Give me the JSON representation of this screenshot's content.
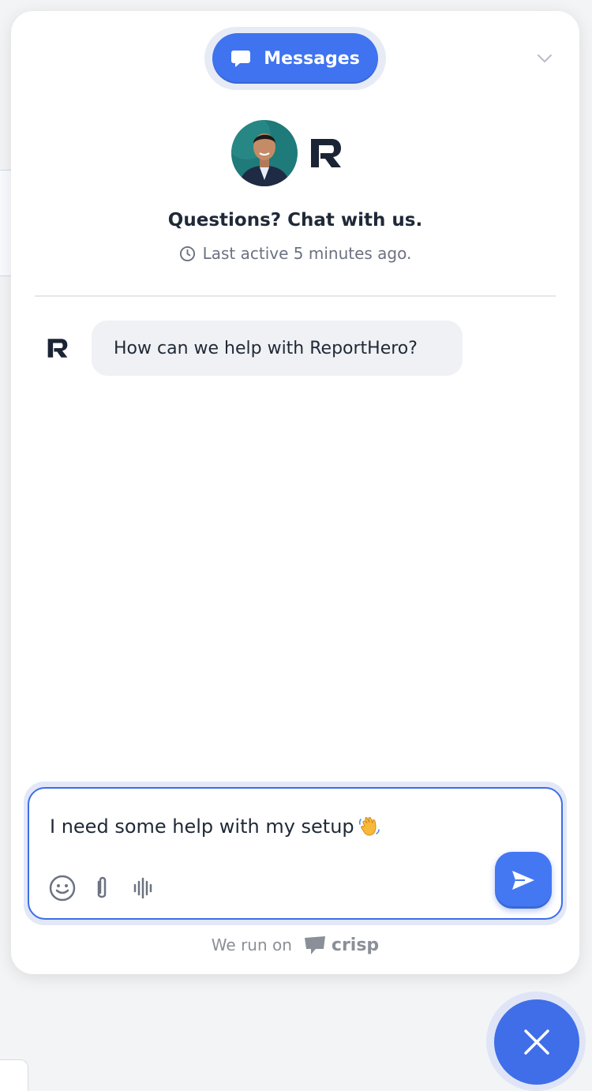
{
  "widget": {
    "tab_label": "Messages",
    "header_title": "Questions? Chat with us.",
    "header_status": "Last active 5 minutes ago."
  },
  "conversation": {
    "messages": [
      {
        "author": "ReportHero",
        "text": "How can we help with ReportHero?"
      }
    ]
  },
  "composer": {
    "input_value": "I need some help with my setup"
  },
  "footer": {
    "powered_by": "We run on",
    "brand": "crisp"
  },
  "colors": {
    "accent": "#3f73f0",
    "bubble": "#f0f1f4",
    "text": "#1f2937",
    "muted": "#6b7280"
  },
  "icons": {
    "tab": "chat-bubble-icon",
    "collapse": "chevron-down-icon",
    "status": "clock-icon",
    "emoji": "smiley-icon",
    "attach": "paperclip-icon",
    "voice": "waveform-icon",
    "send": "send-icon",
    "close": "close-icon",
    "wave": "waving-hand-icon"
  }
}
